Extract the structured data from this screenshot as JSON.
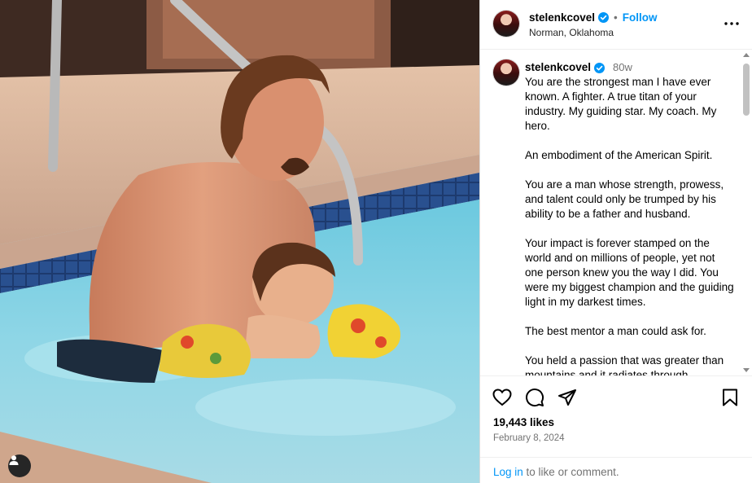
{
  "post": {
    "username": "stelenkcovel",
    "follow_label": "Follow",
    "separator": "•",
    "location": "Norman, Oklahoma"
  },
  "caption": {
    "username": "stelenkcovel",
    "age": "80w",
    "paragraphs": [
      "You are the strongest man I have ever known. A fighter. A true titan of your industry. My guiding star. My coach. My hero.",
      "An embodiment of the American Spirit.",
      "You are a man whose strength, prowess, and talent could only be trumped by his ability to be a father and husband.",
      "Your impact is forever stamped on the world and on millions of people, yet not one person knew you the way I did. You were my biggest champion and the guiding light in my darkest times.",
      "The best mentor a man could ask for.",
      "You held a passion that was greater than mountains and it radiates through"
    ]
  },
  "engagement": {
    "likes": "19,443 likes",
    "date": "February 8, 2024"
  },
  "footer": {
    "login_link": "Log in",
    "login_rest": " to like or comment."
  },
  "icons": {
    "more": "more-options-icon",
    "like": "heart-icon",
    "comment": "comment-icon",
    "share": "share-icon",
    "save": "bookmark-icon",
    "tag": "user-tag-icon",
    "verified": "verified-badge-icon"
  },
  "colors": {
    "accent": "#0095f6",
    "muted": "#737373",
    "border": "#dbdbdb"
  }
}
